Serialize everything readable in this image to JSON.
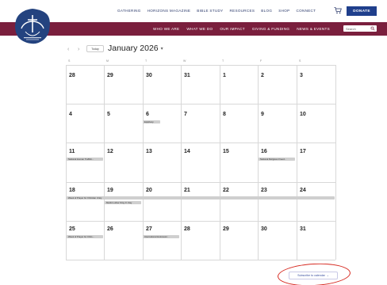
{
  "top_nav": {
    "links": [
      "GATHERING",
      "HORIZONS MAGAZINE",
      "BIBLE STUDY",
      "RESOURCES",
      "BLOG",
      "SHOP",
      "CONNECT"
    ],
    "donate": "DONATE"
  },
  "main_nav": {
    "links": [
      "WHO WE ARE",
      "WHAT WE DO",
      "OUR IMPACT",
      "GIVING & FUNDING",
      "NEWS & EVENTS"
    ],
    "search_placeholder": "Search"
  },
  "calendar": {
    "today_label": "Today",
    "month_label": "January 2026",
    "weekdays": [
      "S",
      "M",
      "T",
      "W",
      "T",
      "F",
      "S"
    ],
    "weeks": [
      [
        "28",
        "29",
        "30",
        "31",
        "1",
        "2",
        "3"
      ],
      [
        "4",
        "5",
        "6",
        "7",
        "8",
        "9",
        "10"
      ],
      [
        "11",
        "12",
        "13",
        "14",
        "15",
        "16",
        "17"
      ],
      [
        "18",
        "19",
        "20",
        "21",
        "22",
        "23",
        "24"
      ],
      [
        "25",
        "26",
        "27",
        "28",
        "29",
        "30",
        "31"
      ]
    ],
    "events": {
      "e1": "Epiphany",
      "e2": "National Human Traffick...",
      "e3": "National Religious Freed...",
      "e4": "Week of Prayer for Christian Unity",
      "e5": "Martin Luther King Jr. Day",
      "e6": "Week of Prayer for Chris...",
      "e7": "International Holocaust ..."
    }
  },
  "subscribe_label": "Subscribe to calendar",
  "colors": {
    "band": "#7a1f3d",
    "donate": "#1f3f8c",
    "annotation": "#d6281f"
  }
}
